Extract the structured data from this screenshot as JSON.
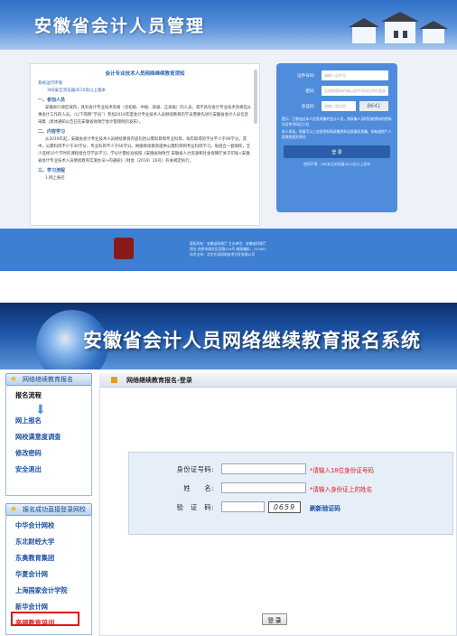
{
  "top": {
    "header_title": "安徽省会计人员管理",
    "notice": {
      "title": "会计专业技术人员网络继续教育须知",
      "link1": "系统运行环境",
      "link2": "360安全浏览器/IE10及以上版本",
      "sections": [
        {
          "heading": "一、参加人员",
          "text": "安徽省行政区域内，具有会计专业技术资格（含初级、中级、高级、正高级）的人员，或不具有会计专业技术资格但从事会计工作的人员。（以下简称“学员”）参加2019年度会计专业技术人员继续教育的学员需要先进行安徽省会计人员信息采集（具体通知公告已在安徽省财政厅会计管理网页发布）。"
        },
        {
          "heading": "二、内容学习",
          "text": "从2019年起，安徽省会计专业技术人员继续教育内容包括公需科目和专业科目，每年取得的学分不少于90学分。其中，公需科目不少于30学分，专业科目不少于60学分。网络继续教育提供公需科目和专业科目学习。每组合一套网校，至少选择10个学时的课程组合可学员学习。学分计量标准按照《安徽省财政厅 安徽省人力资源和社会保障厅关于印发<安徽省会计专业技术人员继续教育实施办法>的通知》（财会〔2019〕26号）有关规定执行。"
        },
        {
          "heading": "三、学习流程",
          "text": "1.网上报名"
        }
      ]
    },
    "login": {
      "id_label": "证件号码：",
      "id_placeholder": "请输入证件号",
      "pwd_label": "密码：",
      "pwd_placeholder": "无初始密码的请以证件号码后四位登录",
      "captcha_label": "验证码：",
      "captcha_placeholder": "请输入验证码",
      "captcha_value": "8641",
      "note1": "提示：已参加过本人信息采集的会计人员，按采集人员时初始密码的密码为证件号码后六位",
      "note2": "本人承诺，所填写以上信息资料和采集资料全部真实准确，如有虚假个人愿承担相关责任",
      "button": "登 录",
      "foot": "使用环境：360安全浏览器/IE10及以上版本"
    },
    "footer": {
      "line1": "版权所有：安徽省财政厅 主办单位：安徽省财政厅",
      "line2": "地址:合肥市政务区西路218号 邮政编码：230061",
      "line3": "技术支持：北京东润网络技术开发有限公司"
    }
  },
  "bottom": {
    "banner_title": "安徽省会计人员网络继续教育报名系统",
    "sidebar": {
      "section1_title": "网络继续教育报名",
      "section1_items": [
        "报名流程",
        "网上报名",
        "网校满意度调查",
        "修改密码",
        "安全退出"
      ],
      "section2_title": "报名成功直接登录网校",
      "section2_items": [
        "中华会计网校",
        "东北财经大学",
        "东奥教育集团",
        "华夏会计网",
        "上海国家会计学院",
        "新华会计网",
        "高顿教育培训"
      ]
    },
    "crumb": "网络继续教育报名-登录",
    "form": {
      "id_label": "身份证号码:",
      "id_hint": "*请输入18位身份证号码",
      "name_label": "姓　　名:",
      "name_hint": "*请输入身份证上的姓名",
      "captcha_label": "验　证　码:",
      "captcha_value": "0659",
      "refresh": "刷新验证码",
      "button": "登 录"
    }
  }
}
